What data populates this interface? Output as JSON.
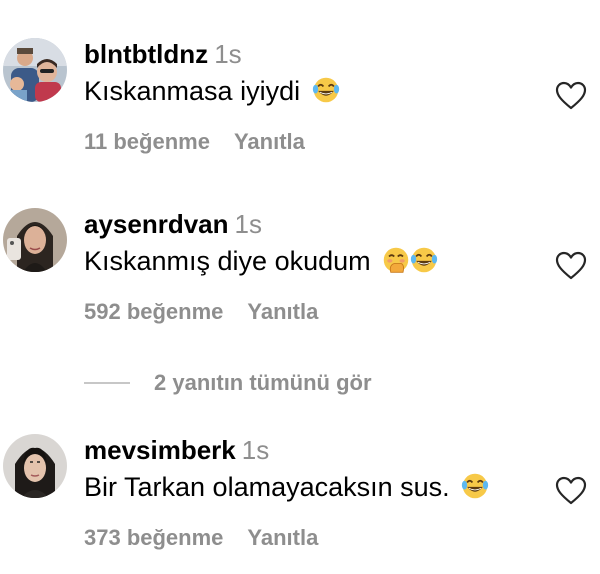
{
  "comments": [
    {
      "username": "blntbtldnz",
      "time": "1s",
      "text": "Kıskanmasa iyiydi",
      "emojis": [
        "tears-of-joy"
      ],
      "likes": "11 beğenme",
      "reply": "Yanıtla"
    },
    {
      "username": "aysenrdvan",
      "time": "1s",
      "text": "Kıskanmış diye okudum",
      "emojis": [
        "hand-over-mouth",
        "tears-of-joy"
      ],
      "likes": "592 beğenme",
      "reply": "Yanıtla"
    },
    {
      "username": "mevsimberk",
      "time": "1s",
      "text": "Bir Tarkan olamayacaksın sus.",
      "emojis": [
        "tears-of-joy"
      ],
      "likes": "373 beğenme",
      "reply": "Yanıtla"
    }
  ],
  "view_replies": {
    "label": "2 yanıtın tümünü gör"
  },
  "icons": {
    "like": "heart-outline-icon"
  },
  "colors": {
    "secondary_text": "#8e8e8e",
    "primary_text": "#000000",
    "divider": "#c7c7c7"
  }
}
